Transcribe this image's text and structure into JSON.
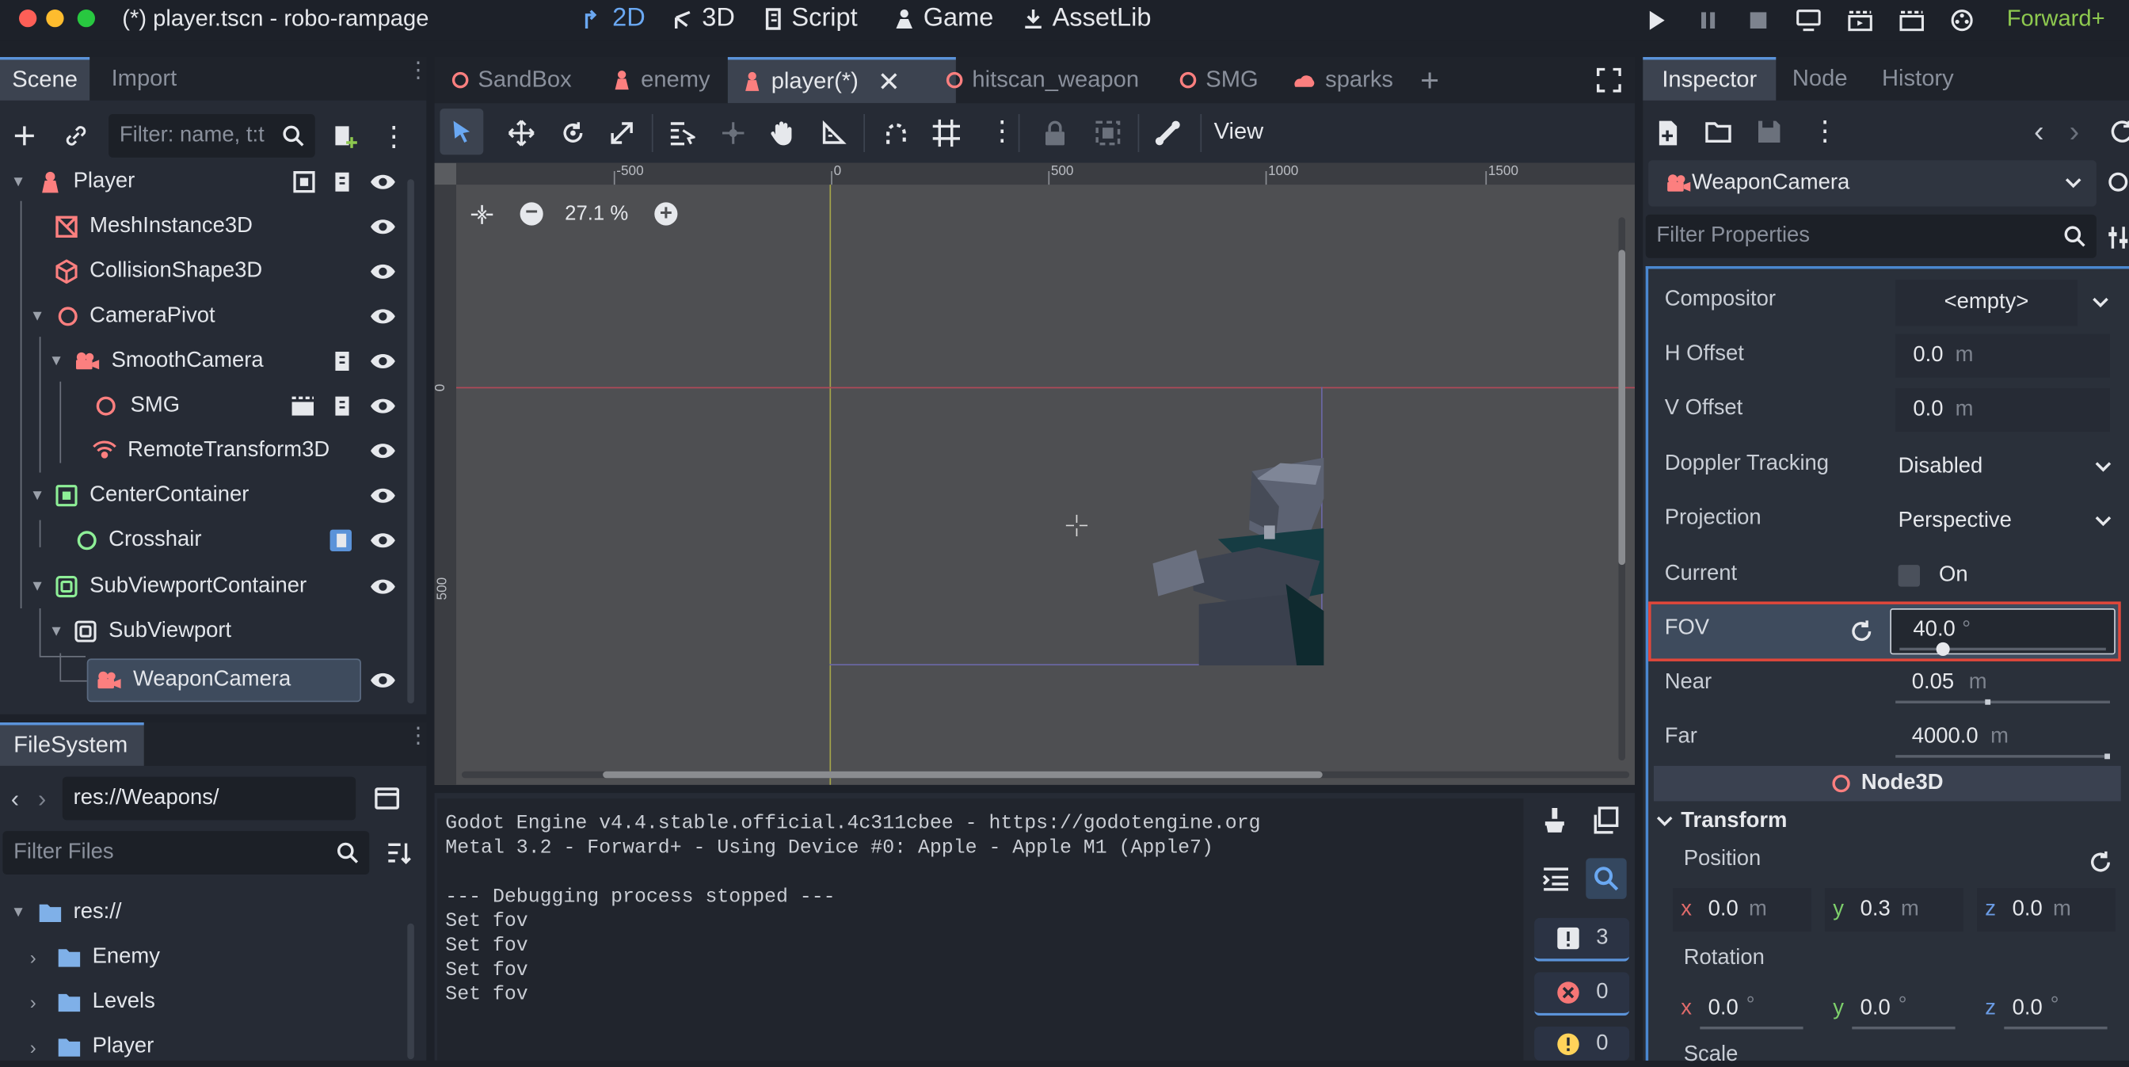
{
  "window": {
    "title": "(*) player.tscn - robo-rampage",
    "renderer": "Forward+"
  },
  "main_buttons": [
    {
      "label": "2D",
      "icon": "2d-icon",
      "active": true
    },
    {
      "label": "3D",
      "icon": "3d-icon"
    },
    {
      "label": "Script",
      "icon": "script-icon"
    },
    {
      "label": "Game",
      "icon": "game-icon"
    },
    {
      "label": "AssetLib",
      "icon": "assetlib-icon"
    }
  ],
  "scene_dock": {
    "tabs": [
      "Scene",
      "Import"
    ],
    "filter_placeholder": "Filter: name, t:t",
    "nodes": [
      {
        "name": "Player",
        "icon": "character-icon"
      },
      {
        "name": "MeshInstance3D",
        "icon": "mesh-icon"
      },
      {
        "name": "CollisionShape3D",
        "icon": "collision-shape-icon"
      },
      {
        "name": "CameraPivot",
        "icon": "node3d-icon"
      },
      {
        "name": "SmoothCamera",
        "icon": "camera-icon"
      },
      {
        "name": "SMG",
        "icon": "node3d-icon"
      },
      {
        "name": "RemoteTransform3D",
        "icon": "remote-transform-icon"
      },
      {
        "name": "CenterContainer",
        "icon": "center-container-icon"
      },
      {
        "name": "Crosshair",
        "icon": "control-icon"
      },
      {
        "name": "SubViewportContainer",
        "icon": "subviewport-container-icon"
      },
      {
        "name": "SubViewport",
        "icon": "subviewport-icon"
      },
      {
        "name": "WeaponCamera",
        "icon": "camera-icon",
        "selected": true
      }
    ]
  },
  "filesystem": {
    "tab": "FileSystem",
    "path": "res://Weapons/",
    "filter_placeholder": "Filter Files",
    "items": [
      "res://",
      "Enemy",
      "Levels",
      "Player"
    ]
  },
  "editor_tabs": [
    "SandBox",
    "enemy",
    "player(*)",
    "hitscan_weapon",
    "SMG",
    "sparks"
  ],
  "viewport": {
    "zoom": "27.1 %",
    "view_menu": "View",
    "ruler_x": [
      "-500",
      "0",
      "500",
      "1000",
      "1500"
    ],
    "ruler_y": [
      "0",
      "500"
    ]
  },
  "output": {
    "lines": [
      "Godot Engine v4.4.stable.official.4c311cbee - https://godotengine.org",
      "Metal 3.2 - Forward+ - Using Device #0: Apple - Apple M1 (Apple7)",
      "",
      "--- Debugging process stopped ---",
      "Set fov",
      "Set fov",
      "Set fov",
      "Set fov"
    ],
    "counts": {
      "messages": "3",
      "errors": "0",
      "warnings": "0"
    }
  },
  "inspector": {
    "tabs": [
      "Inspector",
      "Node",
      "History"
    ],
    "object": "WeaponCamera",
    "filter_placeholder": "Filter Properties",
    "props": {
      "compositor": {
        "label": "Compositor",
        "value": "<empty>"
      },
      "h_offset": {
        "label": "H Offset",
        "value": "0.0",
        "unit": "m"
      },
      "v_offset": {
        "label": "V Offset",
        "value": "0.0",
        "unit": "m"
      },
      "doppler": {
        "label": "Doppler Tracking",
        "value": "Disabled"
      },
      "projection": {
        "label": "Projection",
        "value": "Perspective"
      },
      "current": {
        "label": "Current",
        "value": "On",
        "checked": false
      },
      "fov": {
        "label": "FOV",
        "value": "40.0",
        "unit": "°",
        "slider_fraction": 0.21
      },
      "near": {
        "label": "Near",
        "value": "0.05",
        "unit": "m"
      },
      "far": {
        "label": "Far",
        "value": "4000.0",
        "unit": "m"
      }
    },
    "section": "Node3D",
    "transform": {
      "label": "Transform",
      "position_label": "Position",
      "position": {
        "x": "0.0",
        "y": "0.3",
        "z": "0.0",
        "unit": "m"
      },
      "rotation_label": "Rotation",
      "rotation": {
        "x": "0.0",
        "y": "0.0",
        "z": "0.0",
        "unit": "°"
      },
      "scale_label": "Scale"
    }
  },
  "colors": {
    "accent": "#5b93d9",
    "node3d": "#fc7f7f",
    "control": "#8eef97",
    "highlight": "#e2473a",
    "renderer": "#8ec94f"
  }
}
